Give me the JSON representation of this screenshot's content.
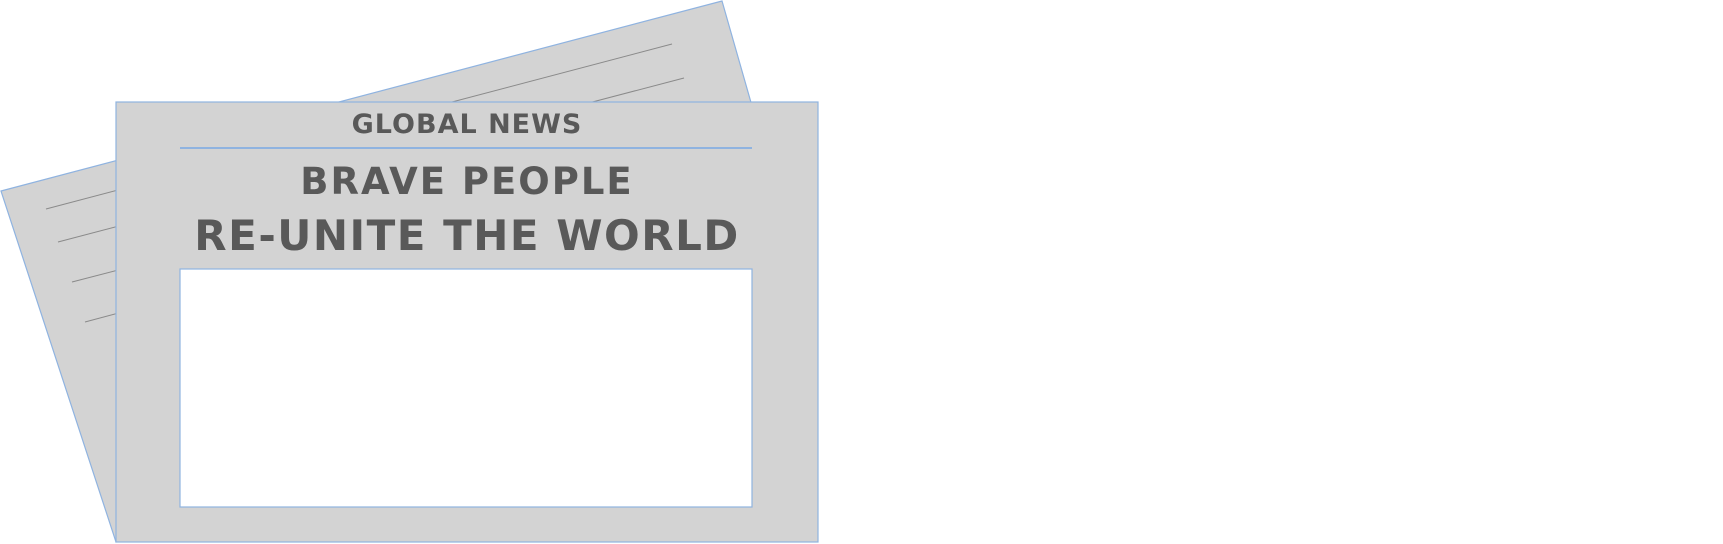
{
  "newspaper": {
    "masthead": "GLOBAL NEWS",
    "headline_line1": "BRAVE PEOPLE",
    "headline_line2": "RE-UNITE THE WORLD"
  },
  "colors": {
    "paper": "#d3d3d3",
    "outline": "#8fb3e0",
    "rule": "#8fb3e0",
    "text_ink": "#595959",
    "back_lines": "#8a8a8a",
    "photo_box": "#ffffff",
    "background": "#ffffff"
  }
}
